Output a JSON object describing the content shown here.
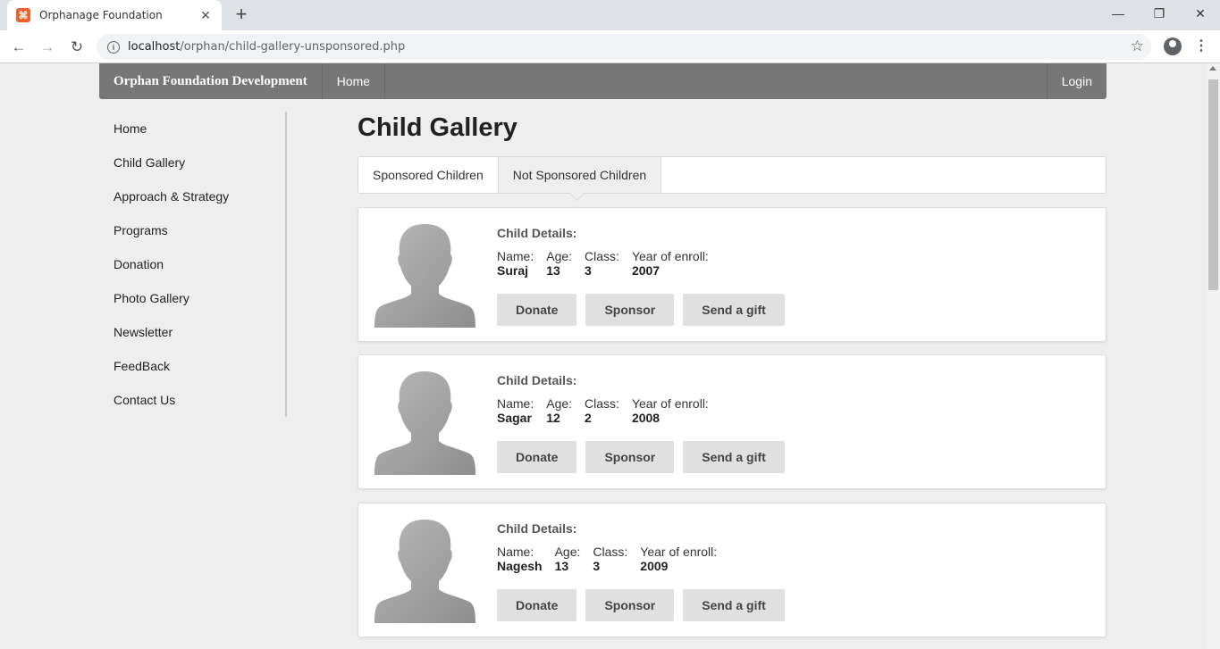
{
  "browser": {
    "tab_title": "Orphanage Foundation",
    "url_host": "localhost",
    "url_path": "/orphan/child-gallery-unsponsored.php"
  },
  "navbar": {
    "brand": "Orphan Foundation Development",
    "home": "Home",
    "login": "Login"
  },
  "sidebar": {
    "items": [
      {
        "label": "Home"
      },
      {
        "label": "Child Gallery"
      },
      {
        "label": "Approach & Strategy"
      },
      {
        "label": "Programs"
      },
      {
        "label": "Donation"
      },
      {
        "label": "Photo Gallery"
      },
      {
        "label": "Newsletter"
      },
      {
        "label": "FeedBack"
      },
      {
        "label": "Contact Us"
      }
    ]
  },
  "main": {
    "title": "Child Gallery",
    "tabs": [
      {
        "label": "Sponsored Children"
      },
      {
        "label": "Not Sponsored Children"
      }
    ],
    "details_heading": "Child Details:",
    "field_labels": {
      "name": "Name:",
      "age": "Age:",
      "class": "Class:",
      "year": "Year of enroll:"
    },
    "buttons": {
      "donate": "Donate",
      "sponsor": "Sponsor",
      "gift": "Send a gift"
    },
    "children": [
      {
        "name": "Suraj",
        "age": "13",
        "class": "3",
        "year": "2007"
      },
      {
        "name": "Sagar",
        "age": "12",
        "class": "2",
        "year": "2008"
      },
      {
        "name": "Nagesh",
        "age": "13",
        "class": "3",
        "year": "2009"
      }
    ]
  }
}
